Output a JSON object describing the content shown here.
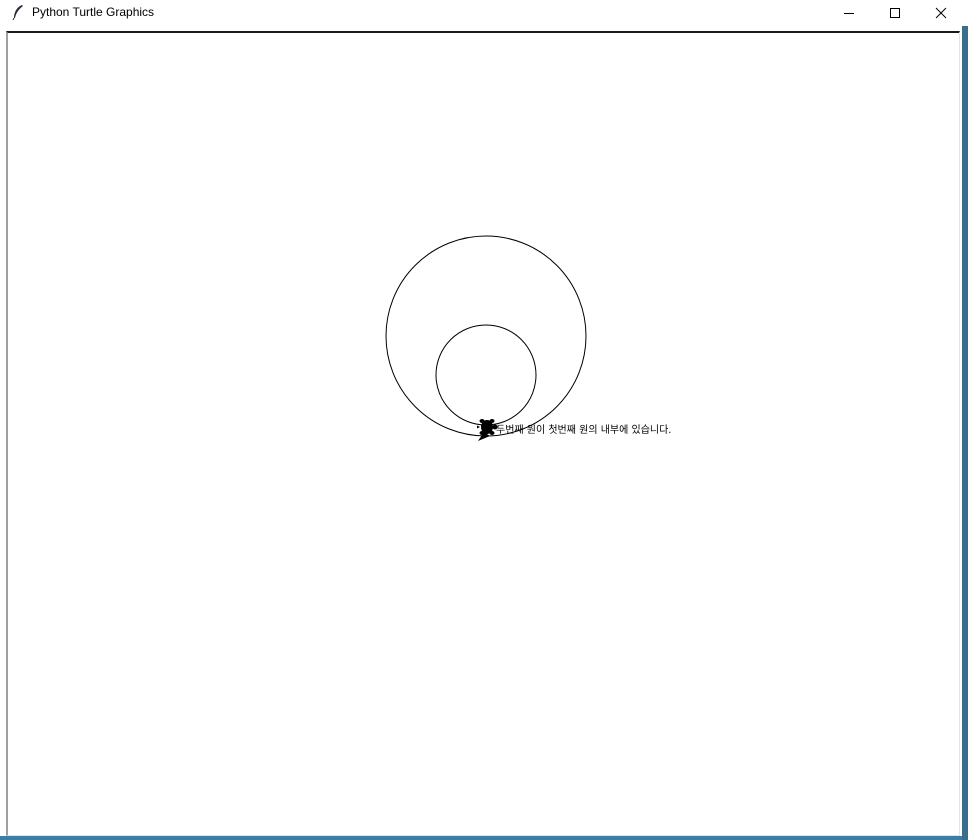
{
  "window": {
    "title": "Python Turtle Graphics",
    "icon": "feather-icon",
    "controls": {
      "minimize_icon": "minimize-icon",
      "maximize_icon": "maximize-icon",
      "close_icon": "close-icon"
    }
  },
  "canvas": {
    "background": "#ffffff",
    "stroke_color": "#000000",
    "message": "두번째 원이 첫번째 원의 내부에 있습니다.",
    "turtle_icon": "turtle-icon",
    "arrow_icon": "arrow-cursor-icon"
  },
  "colors": {
    "desktop_edge_right": "#3b6e8c",
    "desktop_edge_bottom": "#3a7fa8"
  }
}
